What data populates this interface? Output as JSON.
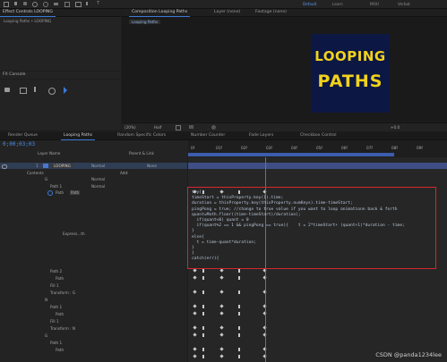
{
  "toolbar": {
    "default_label": "Default",
    "learn_label": "Learn",
    "mode_a": "MOU",
    "mode_b": "Verbat"
  },
  "left_panel": {
    "tab_label": "Effect Controls LOOPING",
    "subtitle": "Looping Paths • LOOPING",
    "fx_console_label": "FX Console"
  },
  "comp_panel": {
    "tab_label": "Composition Looping Paths",
    "layer_tab": "Layer (none)",
    "footage_tab": "Footage (none)",
    "comp_chip": "Looping Paths",
    "poster_line1": "LOOPING",
    "poster_line2": "PATHS",
    "poster_bg": "#0c1744",
    "poster_fg": "#f2d21a",
    "zoom": "(20%)",
    "resolution": "Half",
    "exposure": "+0.0"
  },
  "timeline_tabs": [
    "Render Queue",
    "Looping Paths",
    "Random Specific Colors",
    "Number Counter",
    "Fade Layers",
    "Checkbox Control"
  ],
  "timeline": {
    "timecode": "0;00;03;03",
    "col_layer_name": "Layer Name",
    "col_parent": "Parent & Link",
    "ruler": [
      "0f",
      "01f",
      "02f",
      "03f",
      "04f",
      "05f",
      "06f",
      "07f",
      "08f",
      "09f"
    ],
    "playhead_ratio": 0.298
  },
  "layers": {
    "main_name": "LOOPING",
    "main_index": "1",
    "main_mode": "Normal",
    "main_parent": "None",
    "contents": "Contents",
    "add_label": "Add:",
    "group_g": "G",
    "path1": "Path 1",
    "path_label": "Path",
    "fill_label": "Normal",
    "expression_label": "Express...th",
    "rows": [
      {
        "name": "Path 2",
        "indent": 1
      },
      {
        "name": "Path",
        "indent": 2
      },
      {
        "name": "Fill 1",
        "indent": 1
      },
      {
        "name": "Transform : G",
        "indent": 1
      },
      {
        "name": "N",
        "indent": 0
      },
      {
        "name": "Path 1",
        "indent": 1
      },
      {
        "name": "Path",
        "indent": 2
      },
      {
        "name": "Fill 1",
        "indent": 1
      },
      {
        "name": "Transform : N",
        "indent": 1
      },
      {
        "name": "G",
        "indent": 0
      },
      {
        "name": "Path 1",
        "indent": 1
      },
      {
        "name": "Path",
        "indent": 2
      }
    ]
  },
  "code_lines": [
    "try{",
    "timeStart = thisProperty.key(1).time;",
    "duration = thisProperty.key(thisProperty.numKeys).time-timeStart;",
    "pingPong = true; //change to true value if you want to loop animationn back & forth",
    "quant=Math.floor((time-timeStart)/duration);",
    "  if(quant<0) quant = 0",
    "  if(quant%2 == 1 && pingPong == true){    t = 2*timeStart+ (quant+1)*duration - time;",
    "}",
    "else{",
    "  t = time-quant*duration;",
    "}",
    "}",
    "catch(err){"
  ],
  "watermark": "CSDN @panda1234lee",
  "accent_blue": "#3a7ad8",
  "highlight_red": "#d7262a"
}
